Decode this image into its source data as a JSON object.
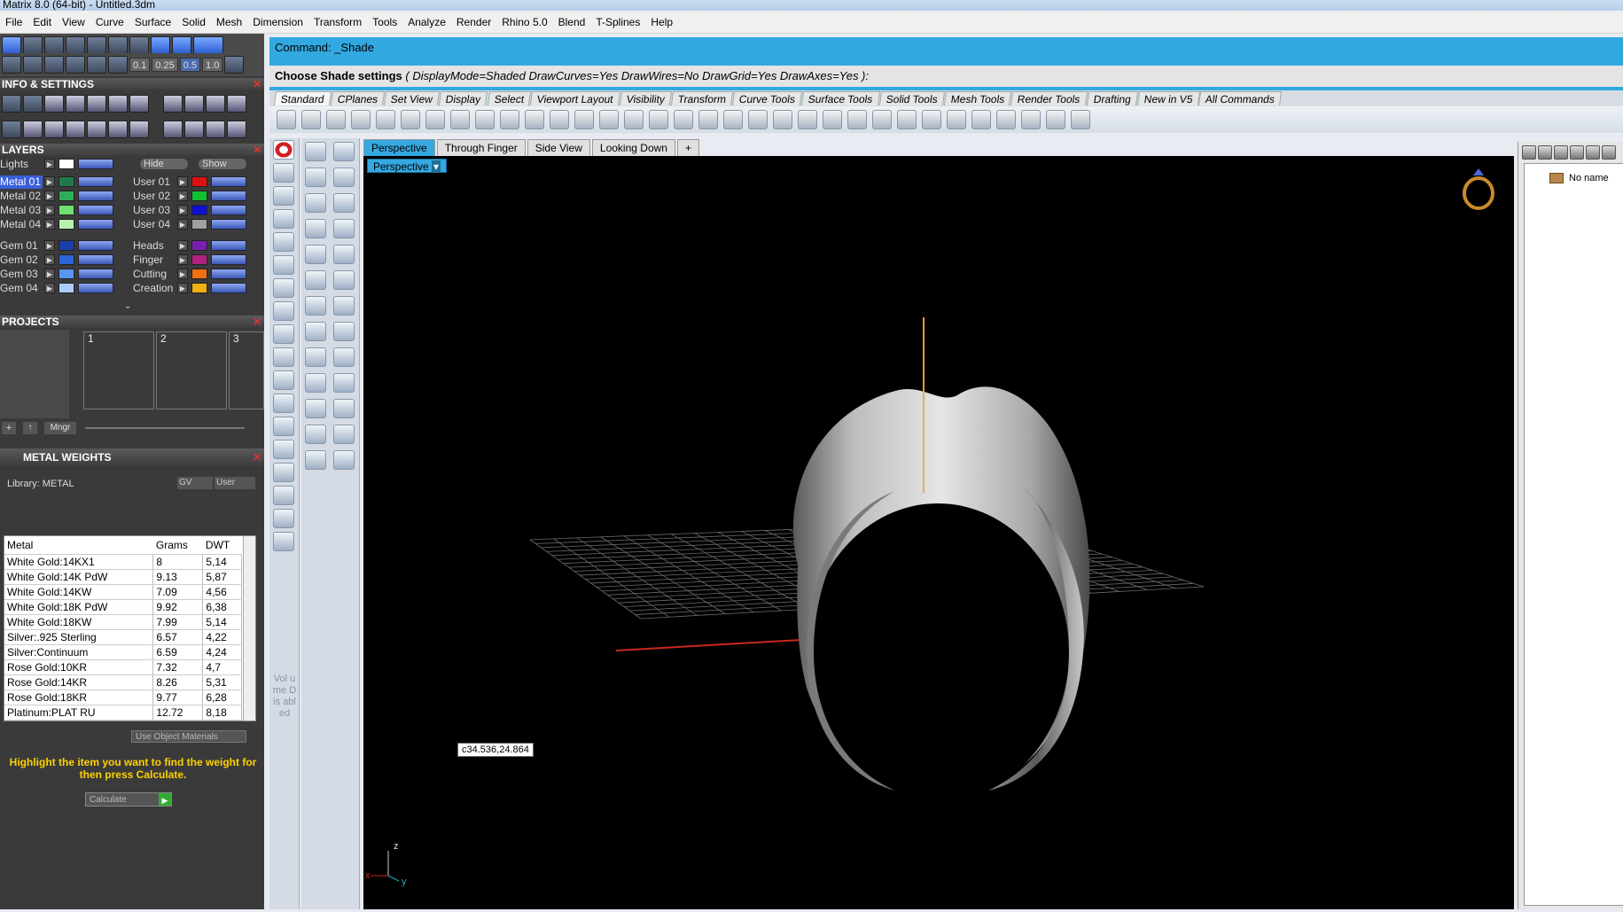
{
  "window": {
    "title": "Matrix 8.0 (64-bit) - Untitled.3dm"
  },
  "menu": [
    "File",
    "Edit",
    "View",
    "Curve",
    "Surface",
    "Solid",
    "Mesh",
    "Dimension",
    "Transform",
    "Tools",
    "Analyze",
    "Render",
    "Rhino 5.0",
    "Blend",
    "T-Splines",
    "Help"
  ],
  "toolbar_numbers": [
    "0.1",
    "0.25",
    "0.5",
    "1.0"
  ],
  "info_settings": {
    "title": "INFO & SETTINGS"
  },
  "layers": {
    "title": "LAYERS",
    "lights_label": "Lights",
    "hide_label": "Hide",
    "show_label": "Show",
    "left": [
      {
        "name": "Metal 01",
        "color": "#1f7a4a",
        "selected": true
      },
      {
        "name": "Metal 02",
        "color": "#2fae5a"
      },
      {
        "name": "Metal 03",
        "color": "#6fe06f"
      },
      {
        "name": "Metal 04",
        "color": "#b8f0b0"
      },
      {
        "name": "Gem 01",
        "color": "#1b3fa8"
      },
      {
        "name": "Gem 02",
        "color": "#2c64d8"
      },
      {
        "name": "Gem 03",
        "color": "#5a96f0"
      },
      {
        "name": "Gem 04",
        "color": "#a8ccff"
      }
    ],
    "right": [
      {
        "name": "User 01",
        "color": "#e01010"
      },
      {
        "name": "User 02",
        "color": "#10c030"
      },
      {
        "name": "User 03",
        "color": "#1010d0"
      },
      {
        "name": "User 04",
        "color": "#a0a0a0"
      },
      {
        "name": "Heads",
        "color": "#7a1fb0"
      },
      {
        "name": "Finger",
        "color": "#b02080"
      },
      {
        "name": "Cutting",
        "color": "#f07010"
      },
      {
        "name": "Creation",
        "color": "#f0b010"
      }
    ]
  },
  "projects": {
    "title": "PROJECTS",
    "slots": [
      "1",
      "2",
      "3"
    ],
    "mngr_label": "Mngr"
  },
  "metal_weights": {
    "title": "METAL WEIGHTS",
    "library": "Library: METAL",
    "gv_label": "GV",
    "user_label": "User",
    "columns": [
      "Metal",
      "Grams",
      "DWT"
    ],
    "rows": [
      [
        "White Gold:14KX1",
        "8",
        "5,14"
      ],
      [
        "White Gold:14K PdW",
        "9.13",
        "5,87"
      ],
      [
        "White Gold:14KW",
        "7.09",
        "4,56"
      ],
      [
        "White Gold:18K PdW",
        "9.92",
        "6,38"
      ],
      [
        "White Gold:18KW",
        "7.99",
        "5,14"
      ],
      [
        "Silver:.925 Sterling",
        "6.57",
        "4,22"
      ],
      [
        "Silver:Continuum",
        "6.59",
        "4,24"
      ],
      [
        "Rose Gold:10KR",
        "7.32",
        "4,7"
      ],
      [
        "Rose Gold:14KR",
        "8.26",
        "5,31"
      ],
      [
        "Rose Gold:18KR",
        "9.77",
        "6,28"
      ],
      [
        "Platinum:PLAT RU",
        "12.72",
        "8,18"
      ]
    ],
    "use_object_materials": "Use Object Materials",
    "hint": "Highlight the item you want to find the weight for then press Calculate.",
    "calculate_label": "Calculate"
  },
  "command": {
    "line1": "Command: _Shade",
    "line2_prefix": "Choose Shade settings",
    "line2_options": "( DisplayMode=Shaded  DrawCurves=Yes  DrawWires=No  DrawGrid=Yes  DrawAxes=Yes ):"
  },
  "toolbar_tabs": [
    "Standard",
    "CPlanes",
    "Set View",
    "Display",
    "Select",
    "Viewport Layout",
    "Visibility",
    "Transform",
    "Curve Tools",
    "Surface Tools",
    "Solid Tools",
    "Mesh Tools",
    "Render Tools",
    "Drafting",
    "New in V5",
    "All Commands"
  ],
  "left_vtool_text": "Vol u me Dis abl ed",
  "viewport": {
    "tabs": [
      "Perspective",
      "Through Finger",
      "Side View",
      "Looking Down"
    ],
    "add_tab": "+",
    "label": "Perspective",
    "coordinate": "c34.536,24.864",
    "axis_z": "z",
    "axis_y": "y",
    "axis_x": "x",
    "colors": {
      "x_axis": "#c8281e",
      "y_axis": "#2aa8c8",
      "z_axis": "#e0a030",
      "grid": "#6a6a6a",
      "background": "#000000"
    }
  },
  "right_panel": {
    "item": "No name"
  }
}
